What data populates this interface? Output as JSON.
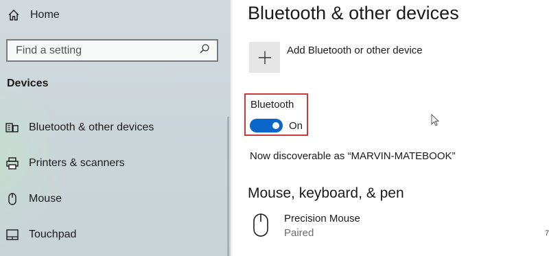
{
  "sidebar": {
    "home_label": "Home",
    "search_placeholder": "Find a setting",
    "section_label": "Devices",
    "items": [
      {
        "label": "Bluetooth & other devices",
        "icon": "bluetooth-devices-icon"
      },
      {
        "label": "Printers & scanners",
        "icon": "printer-icon"
      },
      {
        "label": "Mouse",
        "icon": "mouse-icon"
      },
      {
        "label": "Touchpad",
        "icon": "touchpad-icon"
      }
    ]
  },
  "main": {
    "title": "Bluetooth & other devices",
    "add_device_label": "Add Bluetooth or other device",
    "bluetooth": {
      "title": "Bluetooth",
      "toggle_state": "On",
      "enabled": true
    },
    "discoverable_text": "Now discoverable as “MARVIN-MATEBOOK”",
    "section_heading": "Mouse, keyboard, & pen",
    "device": {
      "name": "Precision Mouse",
      "status": "Paired",
      "icon": "mouse-icon"
    },
    "edge_mark": "7"
  },
  "colors": {
    "accent": "#0a67c9",
    "highlight_border": "#c8393b",
    "sidebar_bg": "#cdd6da"
  }
}
